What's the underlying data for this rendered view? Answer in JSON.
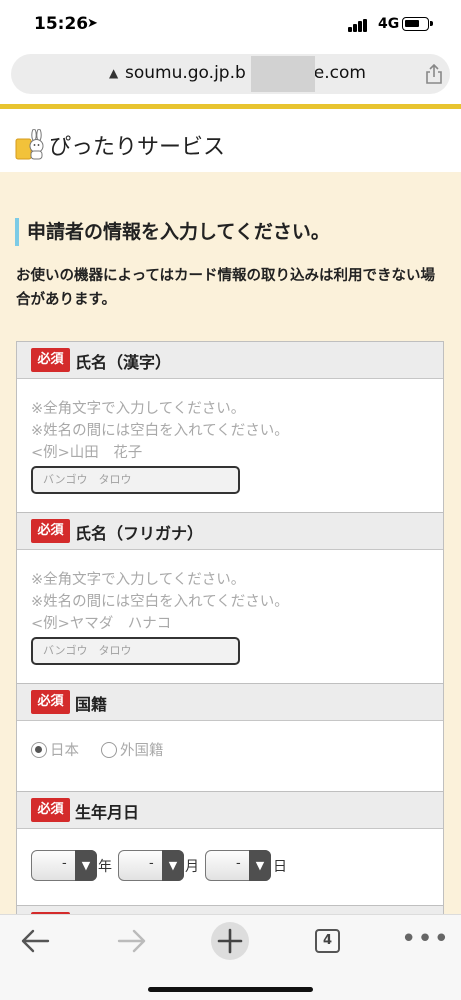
{
  "status_bar": {
    "time": "15:26",
    "network": "4G"
  },
  "browser": {
    "url_prefix": "soumu.go.jp.b",
    "url_suffix": "e.com",
    "tab_count": "4"
  },
  "site": {
    "title": "ぴったりサービス"
  },
  "page": {
    "heading": "申請者の情報を入力してください。",
    "notice": "お使いの機器によってはカード情報の取り込みは利用できない場合があります。"
  },
  "fields": {
    "required_badge": "必須",
    "name_kanji": {
      "label": "氏名（漢字）",
      "hints": [
        "※全角文字で入力してください。",
        "※姓名の間には空白を入れてください。",
        "<例>山田　花子"
      ],
      "placeholder": "バンゴウ　タロウ"
    },
    "name_kana": {
      "label": "氏名（フリガナ）",
      "hints": [
        "※全角文字で入力してください。",
        "※姓名の間には空白を入れてください。",
        "<例>ヤマダ　ハナコ"
      ],
      "placeholder": "バンゴウ　タロウ"
    },
    "nationality": {
      "label": "国籍",
      "options": [
        "日本",
        "外国籍"
      ],
      "selected": "日本"
    },
    "birthdate": {
      "label": "生年月日",
      "year_value": "-",
      "month_value": "-",
      "day_value": "-",
      "year_unit": "年",
      "month_unit": "月",
      "day_unit": "日"
    }
  },
  "colors": {
    "accent_yellow": "#e8c42f",
    "page_bg": "#fbf1da",
    "required_red": "#d42b2b",
    "heading_bar": "#7ccbe6"
  }
}
